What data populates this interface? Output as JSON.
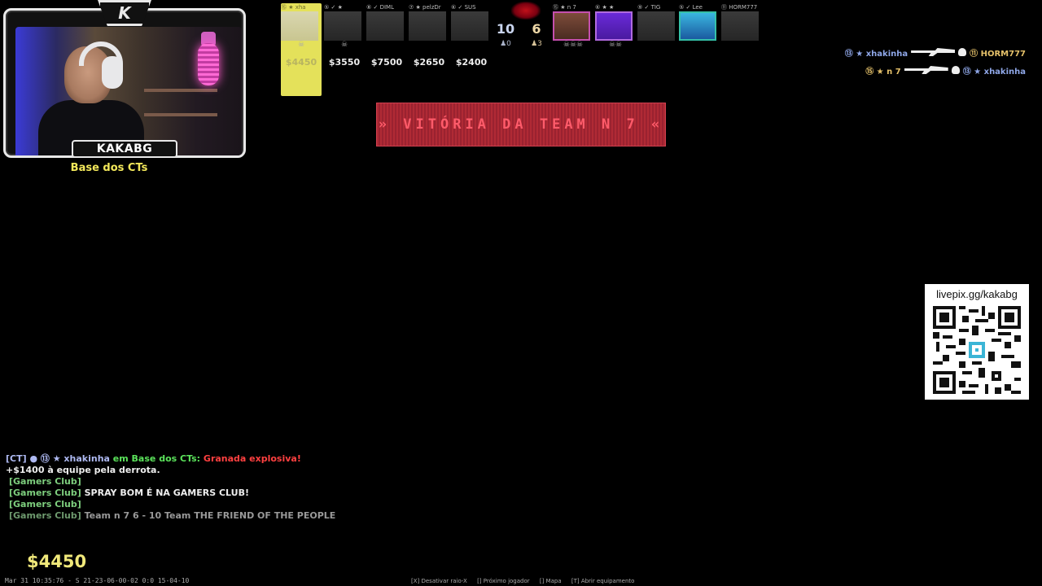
{
  "webcam": {
    "streamer_name": "KAKABG",
    "logo_letter": "K"
  },
  "location": "Base dos CTs",
  "scoreboard": {
    "ct_players": [
      {
        "head": "⑮ ★ xha",
        "money": "$4450",
        "icon": "☠",
        "active": true
      },
      {
        "head": "⑤ ✓ ★",
        "money": "$3550",
        "icon": "☠",
        "active": false
      },
      {
        "head": "⑧ ✓ DIML",
        "money": "$7500",
        "icon": "",
        "active": false
      },
      {
        "head": "⑦ ★ pelzDr",
        "money": "$2650",
        "icon": "",
        "active": false
      },
      {
        "head": "⑥ ✓ SUS",
        "money": "$2400",
        "icon": "",
        "active": false
      }
    ],
    "ct_score": "10",
    "t_score": "6",
    "ct_alive": "♟0",
    "t_alive": "♟3",
    "t_players": [
      {
        "head": "⑮ ★ n 7",
        "icon": "☠☠☠"
      },
      {
        "head": "⑥ ★ ★",
        "icon": "☠☠"
      },
      {
        "head": "⑨ ✓ TIG",
        "icon": ""
      },
      {
        "head": "⑤ ✓ Lee",
        "icon": ""
      },
      {
        "head": "⑪ HORM777",
        "icon": ""
      }
    ]
  },
  "banner": {
    "text": "» VITÓRIA DA TEAM N 7 «"
  },
  "killfeed": [
    {
      "killer": "⑬ ★ xhakinha",
      "victim": "⑪ HORM777"
    },
    {
      "killer": "⑮ ★ n 7",
      "victim": "⑬ ★ xhakinha"
    }
  ],
  "qr": {
    "label": "livepix.gg/kakabg"
  },
  "chat": {
    "line1_tag": "[CT]",
    "line1_player": "● ⑬ ★ xhakinha",
    "line1_loc": "em Base dos CTs:",
    "line1_msg": "Granada explosiva!",
    "line2": "+$1400 à equipe pela derrota.",
    "line3": "[Gamers Club]",
    "line4_tag": "[Gamers Club]",
    "line4_msg": "SPRAY BOM É NA GAMERS CLUB!",
    "line5": "[Gamers Club]",
    "line6_tag": "[Gamers Club]",
    "line6_msg": "Team n 7 6 - 10 Team THE FRIEND OF THE PEOPLE"
  },
  "money": "$4450",
  "footer": {
    "left": "Mar 31 10:35:76 - S 21-23-06-00-02 0:0 15-04-10",
    "hints": [
      "[X] Desativar raio-X",
      "[] Próximo jogador",
      "[] Mapa",
      "[T] Abrir equipamento"
    ]
  }
}
